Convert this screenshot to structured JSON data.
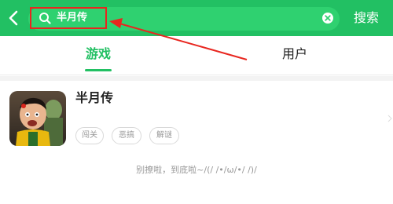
{
  "header": {
    "back_icon": "back-arrow-icon",
    "search_icon": "search-icon",
    "query": "半月传",
    "clear_icon": "clear-icon",
    "search_label": "搜索"
  },
  "tabs": [
    {
      "label": "游戏",
      "active": true
    },
    {
      "label": "用户",
      "active": false
    }
  ],
  "result": {
    "title": "半月传",
    "tags": [
      "闯关",
      "恶搞",
      "解谜"
    ]
  },
  "footer": {
    "text": "别撩啦，到底啦~/(/ /•/ω/•/ /)/"
  },
  "colors": {
    "brand_green": "#22c063",
    "annotation_red": "#e8261f"
  }
}
